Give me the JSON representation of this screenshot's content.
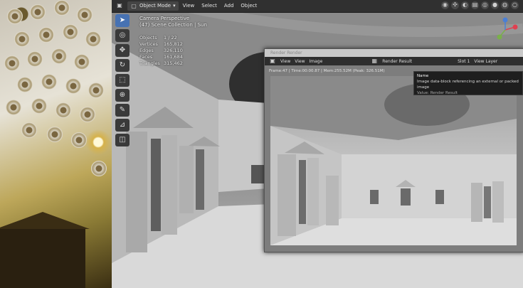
{
  "header": {
    "mode": "Object Mode",
    "menu": [
      "View",
      "Select",
      "Add",
      "Object"
    ]
  },
  "overlay": {
    "line1": "Camera Perspective",
    "line2": "(47) Scene Collection | Sun"
  },
  "stats": {
    "objects_label": "Objects",
    "objects_value": "1 / 22",
    "vertices_label": "Vertices",
    "vertices_value": "165,812",
    "edges_label": "Edges",
    "edges_value": "326,110",
    "faces_label": "Faces",
    "faces_value": "161,684",
    "triangles_label": "Triangles",
    "triangles_value": "315,462"
  },
  "render_window": {
    "title": "Render Render",
    "menu_view": "View",
    "menu_view2": "View",
    "menu_image": "Image",
    "image_name": "Render Result",
    "slot": "Slot 1",
    "view_layer": "View Layer",
    "frame_info": "Frame:47 | Time:00:00.87 | Mem:255.52M (Peak: 326.51M)"
  },
  "tooltip": {
    "title": "Name",
    "desc": "Image data-block referencing an external or packed image",
    "value": "Value: Render Result"
  },
  "colors": {
    "accent": "#4772b3"
  }
}
